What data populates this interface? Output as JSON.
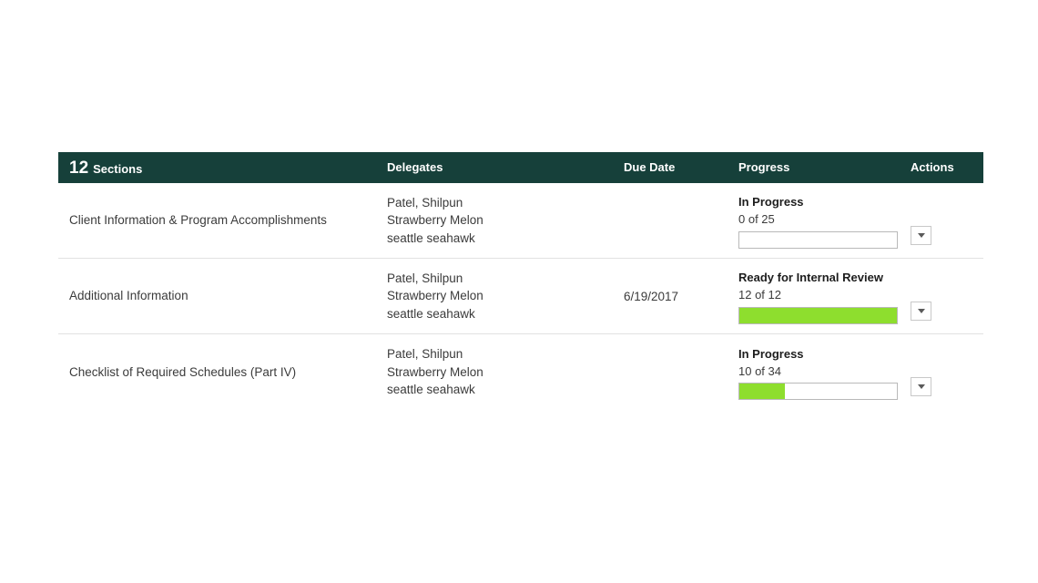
{
  "table": {
    "header": {
      "count": "12",
      "count_label": "Sections",
      "delegates": "Delegates",
      "due_date": "Due Date",
      "progress": "Progress",
      "actions": "Actions",
      "background_color": "#16403a",
      "text_color": "#ffffff"
    },
    "progress_fill_color": "#8ede2e",
    "rows": [
      {
        "section": "Client Information & Program Accomplishments",
        "delegates": [
          "Patel, Shilpun",
          "Strawberry Melon",
          "seattle seahawk"
        ],
        "due_date": "",
        "progress_status": "In Progress",
        "progress_count": "0 of 25",
        "progress_completed": 0,
        "progress_total": 25,
        "progress_percent": 0,
        "action_icon": "chevron-down-icon"
      },
      {
        "section": "Additional Information",
        "delegates": [
          "Patel, Shilpun",
          "Strawberry Melon",
          "seattle seahawk"
        ],
        "due_date": "6/19/2017",
        "progress_status": "Ready for Internal Review",
        "progress_count": "12 of 12",
        "progress_completed": 12,
        "progress_total": 12,
        "progress_percent": 100,
        "action_icon": "chevron-down-icon"
      },
      {
        "section": "Checklist of Required Schedules (Part IV)",
        "delegates": [
          "Patel, Shilpun",
          "Strawberry Melon",
          "seattle seahawk"
        ],
        "due_date": "",
        "progress_status": "In Progress",
        "progress_count": "10 of 34",
        "progress_completed": 10,
        "progress_total": 34,
        "progress_percent": 29,
        "action_icon": "chevron-down-icon"
      }
    ]
  }
}
